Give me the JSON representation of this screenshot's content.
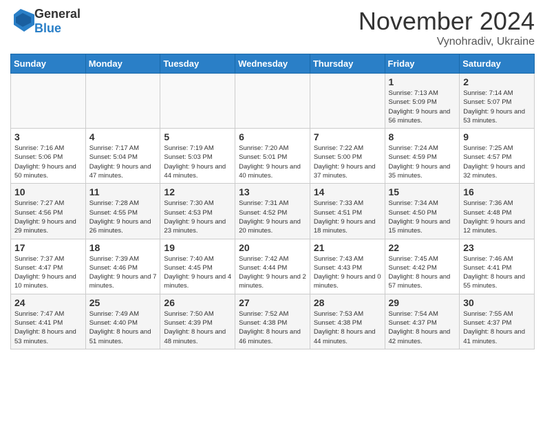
{
  "logo": {
    "general": "General",
    "blue": "Blue"
  },
  "title": "November 2024",
  "location": "Vynohradiv, Ukraine",
  "weekdays": [
    "Sunday",
    "Monday",
    "Tuesday",
    "Wednesday",
    "Thursday",
    "Friday",
    "Saturday"
  ],
  "weeks": [
    [
      {
        "day": "",
        "info": ""
      },
      {
        "day": "",
        "info": ""
      },
      {
        "day": "",
        "info": ""
      },
      {
        "day": "",
        "info": ""
      },
      {
        "day": "",
        "info": ""
      },
      {
        "day": "1",
        "info": "Sunrise: 7:13 AM\nSunset: 5:09 PM\nDaylight: 9 hours and 56 minutes."
      },
      {
        "day": "2",
        "info": "Sunrise: 7:14 AM\nSunset: 5:07 PM\nDaylight: 9 hours and 53 minutes."
      }
    ],
    [
      {
        "day": "3",
        "info": "Sunrise: 7:16 AM\nSunset: 5:06 PM\nDaylight: 9 hours and 50 minutes."
      },
      {
        "day": "4",
        "info": "Sunrise: 7:17 AM\nSunset: 5:04 PM\nDaylight: 9 hours and 47 minutes."
      },
      {
        "day": "5",
        "info": "Sunrise: 7:19 AM\nSunset: 5:03 PM\nDaylight: 9 hours and 44 minutes."
      },
      {
        "day": "6",
        "info": "Sunrise: 7:20 AM\nSunset: 5:01 PM\nDaylight: 9 hours and 40 minutes."
      },
      {
        "day": "7",
        "info": "Sunrise: 7:22 AM\nSunset: 5:00 PM\nDaylight: 9 hours and 37 minutes."
      },
      {
        "day": "8",
        "info": "Sunrise: 7:24 AM\nSunset: 4:59 PM\nDaylight: 9 hours and 35 minutes."
      },
      {
        "day": "9",
        "info": "Sunrise: 7:25 AM\nSunset: 4:57 PM\nDaylight: 9 hours and 32 minutes."
      }
    ],
    [
      {
        "day": "10",
        "info": "Sunrise: 7:27 AM\nSunset: 4:56 PM\nDaylight: 9 hours and 29 minutes."
      },
      {
        "day": "11",
        "info": "Sunrise: 7:28 AM\nSunset: 4:55 PM\nDaylight: 9 hours and 26 minutes."
      },
      {
        "day": "12",
        "info": "Sunrise: 7:30 AM\nSunset: 4:53 PM\nDaylight: 9 hours and 23 minutes."
      },
      {
        "day": "13",
        "info": "Sunrise: 7:31 AM\nSunset: 4:52 PM\nDaylight: 9 hours and 20 minutes."
      },
      {
        "day": "14",
        "info": "Sunrise: 7:33 AM\nSunset: 4:51 PM\nDaylight: 9 hours and 18 minutes."
      },
      {
        "day": "15",
        "info": "Sunrise: 7:34 AM\nSunset: 4:50 PM\nDaylight: 9 hours and 15 minutes."
      },
      {
        "day": "16",
        "info": "Sunrise: 7:36 AM\nSunset: 4:48 PM\nDaylight: 9 hours and 12 minutes."
      }
    ],
    [
      {
        "day": "17",
        "info": "Sunrise: 7:37 AM\nSunset: 4:47 PM\nDaylight: 9 hours and 10 minutes."
      },
      {
        "day": "18",
        "info": "Sunrise: 7:39 AM\nSunset: 4:46 PM\nDaylight: 9 hours and 7 minutes."
      },
      {
        "day": "19",
        "info": "Sunrise: 7:40 AM\nSunset: 4:45 PM\nDaylight: 9 hours and 4 minutes."
      },
      {
        "day": "20",
        "info": "Sunrise: 7:42 AM\nSunset: 4:44 PM\nDaylight: 9 hours and 2 minutes."
      },
      {
        "day": "21",
        "info": "Sunrise: 7:43 AM\nSunset: 4:43 PM\nDaylight: 9 hours and 0 minutes."
      },
      {
        "day": "22",
        "info": "Sunrise: 7:45 AM\nSunset: 4:42 PM\nDaylight: 8 hours and 57 minutes."
      },
      {
        "day": "23",
        "info": "Sunrise: 7:46 AM\nSunset: 4:41 PM\nDaylight: 8 hours and 55 minutes."
      }
    ],
    [
      {
        "day": "24",
        "info": "Sunrise: 7:47 AM\nSunset: 4:41 PM\nDaylight: 8 hours and 53 minutes."
      },
      {
        "day": "25",
        "info": "Sunrise: 7:49 AM\nSunset: 4:40 PM\nDaylight: 8 hours and 51 minutes."
      },
      {
        "day": "26",
        "info": "Sunrise: 7:50 AM\nSunset: 4:39 PM\nDaylight: 8 hours and 48 minutes."
      },
      {
        "day": "27",
        "info": "Sunrise: 7:52 AM\nSunset: 4:38 PM\nDaylight: 8 hours and 46 minutes."
      },
      {
        "day": "28",
        "info": "Sunrise: 7:53 AM\nSunset: 4:38 PM\nDaylight: 8 hours and 44 minutes."
      },
      {
        "day": "29",
        "info": "Sunrise: 7:54 AM\nSunset: 4:37 PM\nDaylight: 8 hours and 42 minutes."
      },
      {
        "day": "30",
        "info": "Sunrise: 7:55 AM\nSunset: 4:37 PM\nDaylight: 8 hours and 41 minutes."
      }
    ]
  ]
}
